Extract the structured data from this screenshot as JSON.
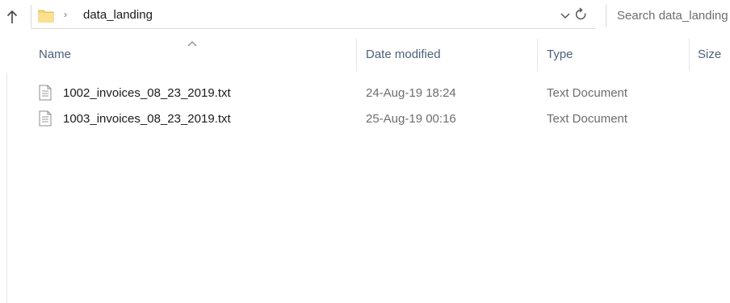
{
  "address_bar": {
    "breadcrumb": "data_landing",
    "search_placeholder": "Search data_landing"
  },
  "columns": {
    "name": "Name",
    "date_modified": "Date modified",
    "type": "Type",
    "size": "Size"
  },
  "files": [
    {
      "name": "1002_invoices_08_23_2019.txt",
      "date_modified": "24-Aug-19 18:24",
      "type": "Text Document",
      "icon": "text-file-icon"
    },
    {
      "name": "1003_invoices_08_23_2019.txt",
      "date_modified": "25-Aug-19 00:16",
      "type": "Text Document",
      "icon": "text-file-icon"
    }
  ],
  "icons": {
    "up": "up-arrow-icon",
    "folder": "folder-icon",
    "breadcrumb_separator": "chevron-right-icon",
    "dropdown": "chevron-down-icon",
    "refresh": "refresh-icon",
    "sort": "sort-ascending-icon"
  },
  "colors": {
    "header_text": "#4c607a",
    "folder_yellow": "#f8d775",
    "secondary_text": "#6d6d6d"
  }
}
